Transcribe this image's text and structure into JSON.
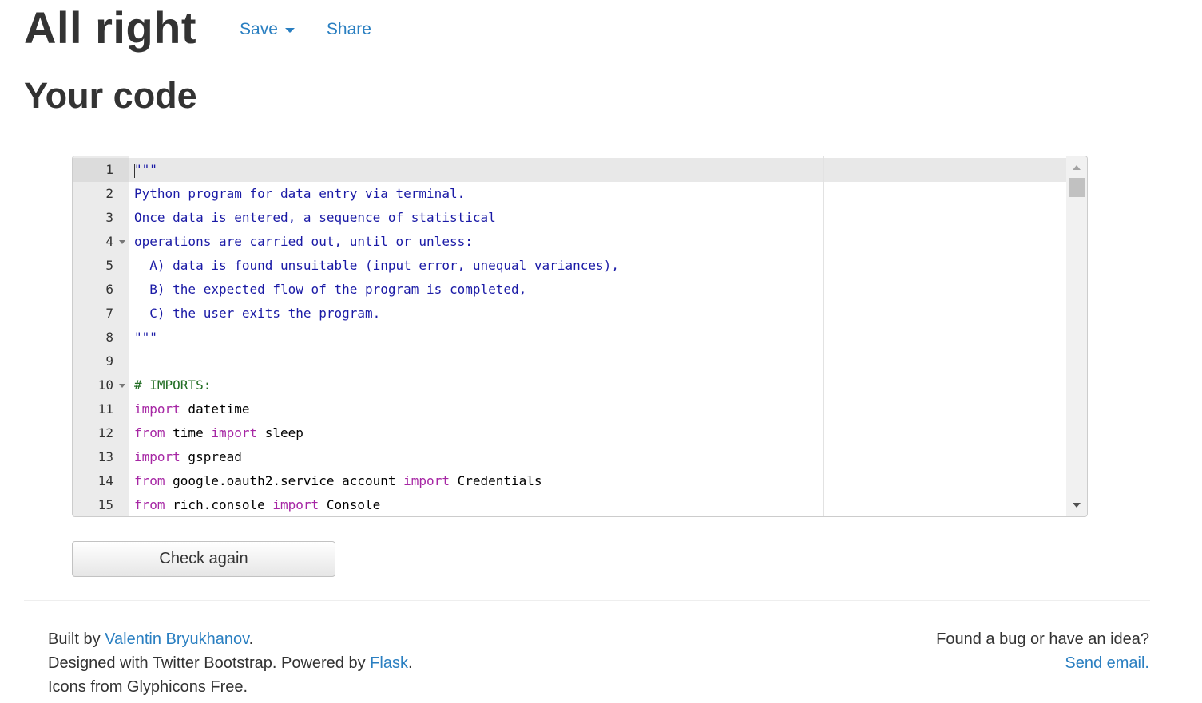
{
  "header": {
    "title": "All right",
    "save_label": "Save",
    "share_label": "Share"
  },
  "main": {
    "section_title": "Your code",
    "check_button_label": "Check again"
  },
  "editor": {
    "lines": [
      {
        "num": "1",
        "fold": false,
        "active": true,
        "tokens": [
          {
            "t": "\"\"\"",
            "c": "str"
          }
        ]
      },
      {
        "num": "2",
        "fold": false,
        "active": false,
        "tokens": [
          {
            "t": "Python program for data entry via terminal.",
            "c": "str"
          }
        ]
      },
      {
        "num": "3",
        "fold": false,
        "active": false,
        "tokens": [
          {
            "t": "Once data is entered, a sequence of statistical",
            "c": "str"
          }
        ]
      },
      {
        "num": "4",
        "fold": true,
        "active": false,
        "tokens": [
          {
            "t": "operations are carried out, until or unless:",
            "c": "str"
          }
        ]
      },
      {
        "num": "5",
        "fold": false,
        "active": false,
        "tokens": [
          {
            "t": "  A) data is found unsuitable (input error, unequal variances),",
            "c": "str"
          }
        ]
      },
      {
        "num": "6",
        "fold": false,
        "active": false,
        "tokens": [
          {
            "t": "  B) the expected flow of the program is completed,",
            "c": "str"
          }
        ]
      },
      {
        "num": "7",
        "fold": false,
        "active": false,
        "tokens": [
          {
            "t": "  C) the user exits the program.",
            "c": "str"
          }
        ]
      },
      {
        "num": "8",
        "fold": false,
        "active": false,
        "tokens": [
          {
            "t": "\"\"\"",
            "c": "str"
          }
        ]
      },
      {
        "num": "9",
        "fold": false,
        "active": false,
        "tokens": []
      },
      {
        "num": "10",
        "fold": true,
        "active": false,
        "tokens": [
          {
            "t": "# IMPORTS:",
            "c": "com"
          }
        ]
      },
      {
        "num": "11",
        "fold": false,
        "active": false,
        "tokens": [
          {
            "t": "import",
            "c": "kw"
          },
          {
            "t": " datetime",
            "c": "id"
          }
        ]
      },
      {
        "num": "12",
        "fold": false,
        "active": false,
        "tokens": [
          {
            "t": "from",
            "c": "kw"
          },
          {
            "t": " time ",
            "c": "id"
          },
          {
            "t": "import",
            "c": "kw"
          },
          {
            "t": " sleep",
            "c": "id"
          }
        ]
      },
      {
        "num": "13",
        "fold": false,
        "active": false,
        "tokens": [
          {
            "t": "import",
            "c": "kw"
          },
          {
            "t": " gspread",
            "c": "id"
          }
        ]
      },
      {
        "num": "14",
        "fold": false,
        "active": false,
        "tokens": [
          {
            "t": "from",
            "c": "kw"
          },
          {
            "t": " google.oauth2.service_account ",
            "c": "id"
          },
          {
            "t": "import",
            "c": "kw"
          },
          {
            "t": " Credentials",
            "c": "id"
          }
        ]
      },
      {
        "num": "15",
        "fold": false,
        "active": false,
        "tokens": [
          {
            "t": "from",
            "c": "kw"
          },
          {
            "t": " rich.console ",
            "c": "id"
          },
          {
            "t": "import",
            "c": "kw"
          },
          {
            "t": " Console",
            "c": "id"
          }
        ]
      }
    ]
  },
  "footer": {
    "built_by_prefix": "Built by ",
    "author_name": "Valentin Bryukhanov",
    "built_by_suffix": ".",
    "designed_prefix": "Designed with Twitter Bootstrap. Powered by ",
    "flask_label": "Flask",
    "designed_suffix": ".",
    "icons_text": "Icons from Glyphicons Free.",
    "bug_question": "Found a bug or have an idea?",
    "send_email_label": "Send email."
  },
  "colors": {
    "link": "#2a7fc1",
    "string": "#1a1aa6",
    "comment": "#236e25",
    "keyword": "#a626a4"
  }
}
